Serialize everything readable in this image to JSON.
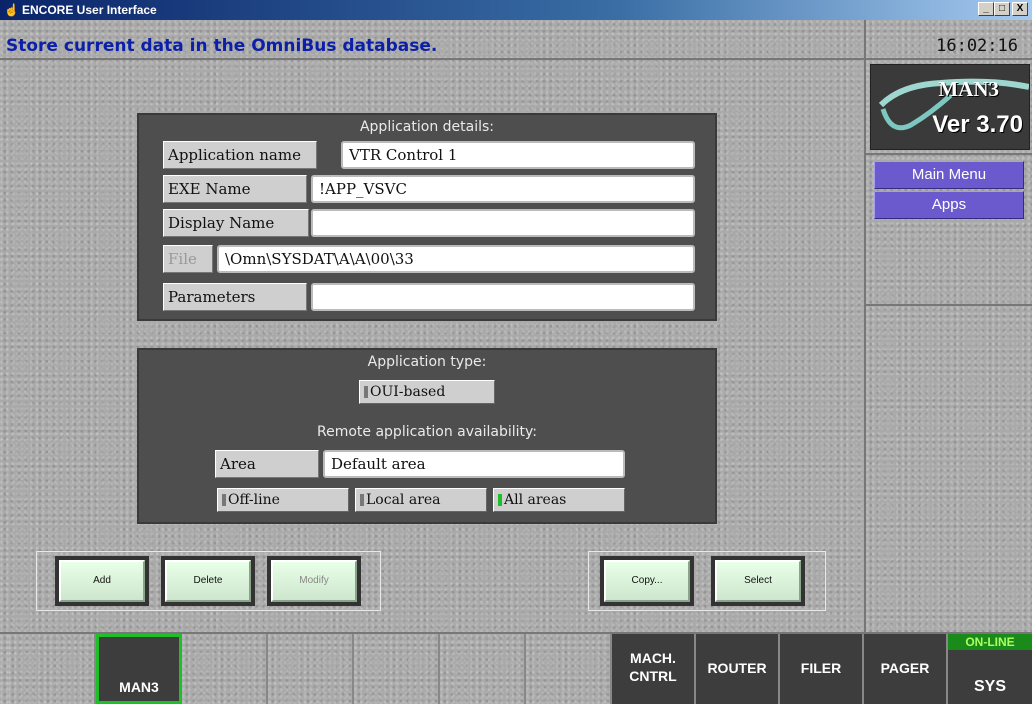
{
  "window": {
    "title": "ENCORE User Interface",
    "min_label": "_",
    "max_label": "□",
    "close_label": "X"
  },
  "status": {
    "message": "Store current data in the OmniBus database.",
    "clock": "16:02:16"
  },
  "logo": {
    "name": "MAN3",
    "version": "Ver 3.70"
  },
  "side_menu": {
    "main_menu": "Main Menu",
    "apps": "Apps"
  },
  "details": {
    "title": "Application details:",
    "rows": [
      {
        "label": "Application name",
        "value": "VTR Control 1"
      },
      {
        "label": "EXE Name",
        "value": "!APP_VSVC"
      },
      {
        "label": "Display Name",
        "value": ""
      },
      {
        "label": "File",
        "value": "\\Omn\\SYSDAT\\A\\A\\00\\33"
      },
      {
        "label": "Parameters",
        "value": ""
      }
    ]
  },
  "app_type": {
    "title": "Application type:",
    "type_value": "OUI-based",
    "remote_title": "Remote application availability:",
    "area_label": "Area",
    "area_value": "Default area",
    "options": [
      {
        "label": "Off-line",
        "selected": false
      },
      {
        "label": "Local area",
        "selected": false
      },
      {
        "label": "All areas",
        "selected": true
      }
    ]
  },
  "actions": {
    "add": "Add",
    "delete": "Delete",
    "modify": "Modify",
    "copy": "Copy...",
    "select": "Select"
  },
  "bottom_tabs": {
    "man3": "MAN3",
    "mach_line1": "MACH.",
    "mach_line2": "CNTRL",
    "router": "ROUTER",
    "filer": "FILER",
    "pager": "PAGER",
    "online": "ON-LINE",
    "sys": "SYS"
  },
  "colors": {
    "status_text": "#0b1fa8",
    "menu_button": "#6a5acd",
    "selected_indicator": "#1fbf2a",
    "panel": "#4e4e4e"
  }
}
